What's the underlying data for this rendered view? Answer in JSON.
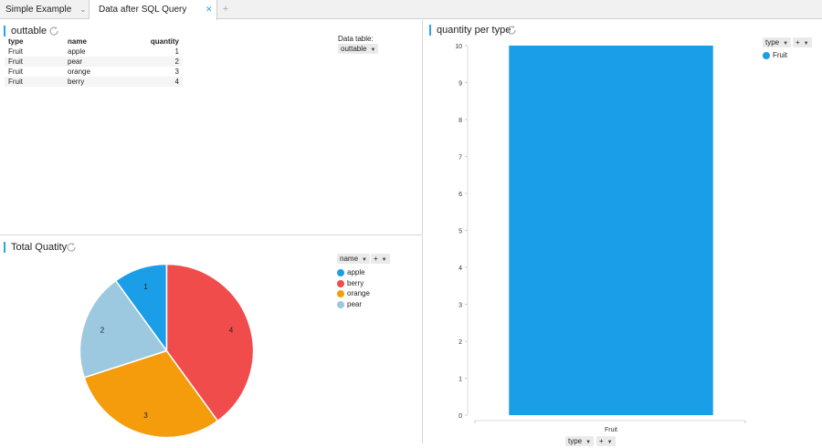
{
  "tabs": [
    {
      "label": "Simple Example data",
      "active": false
    },
    {
      "label": "Data after SQL Query Execution",
      "active": true
    }
  ],
  "table_panel": {
    "title": "outtable",
    "columns": [
      "type",
      "name",
      "quantity"
    ],
    "rows": [
      [
        "Fruit",
        "apple",
        "1"
      ],
      [
        "Fruit",
        "pear",
        "2"
      ],
      [
        "Fruit",
        "orange",
        "3"
      ],
      [
        "Fruit",
        "berry",
        "4"
      ]
    ],
    "data_table_label": "Data table:",
    "data_table_value": "outtable"
  },
  "pie_panel": {
    "title": "Total Quatity",
    "group_by": "name",
    "add_label": "+",
    "legend": [
      {
        "name": "apple",
        "color": "#1a9ee8"
      },
      {
        "name": "berry",
        "color": "#f04c4c"
      },
      {
        "name": "orange",
        "color": "#f59c0c"
      },
      {
        "name": "pear",
        "color": "#9cc9e0"
      }
    ]
  },
  "bar_panel": {
    "title": "quantity per type",
    "group_by": "type",
    "add_label": "+",
    "legend": [
      {
        "name": "Fruit",
        "color": "#1a9ee8"
      }
    ],
    "x_selector": "type",
    "x_add_label": "+"
  },
  "chart_data": [
    {
      "type": "pie",
      "categories": [
        "apple",
        "pear",
        "orange",
        "berry"
      ],
      "values": [
        1,
        2,
        3,
        4
      ],
      "colors": [
        "#1a9ee8",
        "#9cc9e0",
        "#f59c0c",
        "#f04c4c"
      ],
      "title": "Total Quatity",
      "legend_placement": "right"
    },
    {
      "type": "bar",
      "categories": [
        "Fruit"
      ],
      "series": [
        {
          "name": "Fruit",
          "values": [
            10
          ],
          "color": "#1a9ee8"
        }
      ],
      "ylim": [
        0,
        10
      ],
      "yticks": [
        0,
        1,
        2,
        3,
        4,
        5,
        6,
        7,
        8,
        9,
        10
      ],
      "title": "quantity per type",
      "legend_placement": "top-right"
    }
  ]
}
